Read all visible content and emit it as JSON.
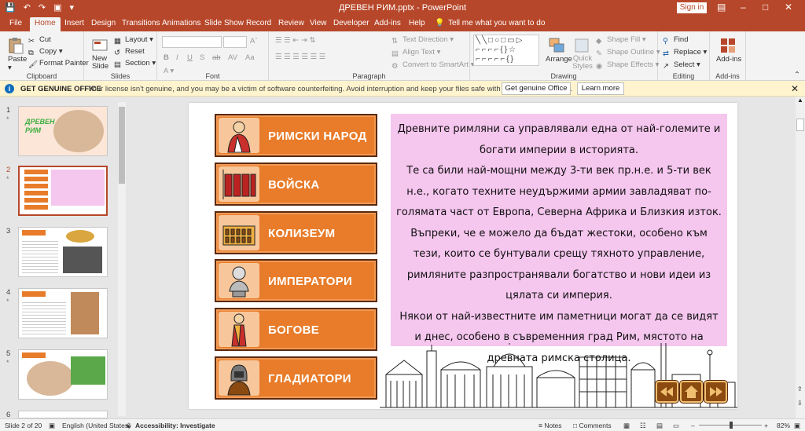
{
  "window": {
    "title": "ДРЕВЕН РИМ.pptx  -  PowerPoint",
    "sign_in": "Sign in"
  },
  "tabs": [
    "File",
    "Home",
    "Insert",
    "Design",
    "Transitions",
    "Animations",
    "Slide Show",
    "Record",
    "Review",
    "View",
    "Developer",
    "Add-ins",
    "Help"
  ],
  "tell_me": "Tell me what you want to do",
  "ribbon": {
    "clipboard": {
      "paste": "Paste",
      "cut": "Cut",
      "copy": "Copy",
      "format_painter": "Format Painter",
      "label": "Clipboard"
    },
    "slides": {
      "new_slide": "New Slide",
      "layout": "Layout",
      "reset": "Reset",
      "section": "Section",
      "label": "Slides"
    },
    "font": {
      "label": "Font"
    },
    "paragraph": {
      "text_direction": "Text Direction",
      "align_text": "Align Text",
      "convert": "Convert to SmartArt",
      "label": "Paragraph"
    },
    "drawing": {
      "arrange": "Arrange",
      "quick_styles": "Quick Styles",
      "shape_fill": "Shape Fill",
      "shape_outline": "Shape Outline",
      "shape_effects": "Shape Effects",
      "label": "Drawing"
    },
    "editing": {
      "find": "Find",
      "replace": "Replace",
      "select": "Select",
      "label": "Editing"
    },
    "addins": {
      "addins": "Add-ins",
      "label": "Add-ins"
    }
  },
  "message_bar": {
    "title": "GET GENUINE OFFICE",
    "text": "Your license isn't genuine, and you may be a victim of software counterfeiting. Avoid interruption and keep your files safe with genuine Office today.",
    "btn1": "Get genuine Office",
    "btn2": "Learn more"
  },
  "thumbnails": [
    {
      "num": "1",
      "title": "ДРЕВЕН РИМ"
    },
    {
      "num": "2"
    },
    {
      "num": "3"
    },
    {
      "num": "4"
    },
    {
      "num": "5"
    },
    {
      "num": "6"
    }
  ],
  "slide": {
    "menu": [
      "РИМСКИ НАРОД",
      "ВОЙСКА",
      "КОЛИЗЕУМ",
      "ИМПЕРАТОРИ",
      "БОГОВЕ",
      "ГЛАДИАТОРИ"
    ],
    "paragraphs": [
      "Древните римляни са управлявали една от най-големите и богати империи в историята.",
      "Те са били най-мощни между 3-ти век пр.н.е. и 5-ти век н.е., когато техните неудържими армии завладяват по-голямата част от Европа, Северна Африка и Близкия изток.",
      "Въпреки, че е можело да бъдат жестоки, особено към тези, които се бунтували срещу тяхното управление, римляните разпространявали богатство и нови идеи из цялата си империя.",
      "Някои от най-известните им паметници могат да се видят и днес, особено в съвременния град Рим, мястото на древната римска столица."
    ]
  },
  "status": {
    "slide": "Slide 2 of 20",
    "language": "English (United States)",
    "accessibility": "Accessibility: Investigate",
    "notes": "Notes",
    "comments": "Comments",
    "zoom": "82%"
  }
}
